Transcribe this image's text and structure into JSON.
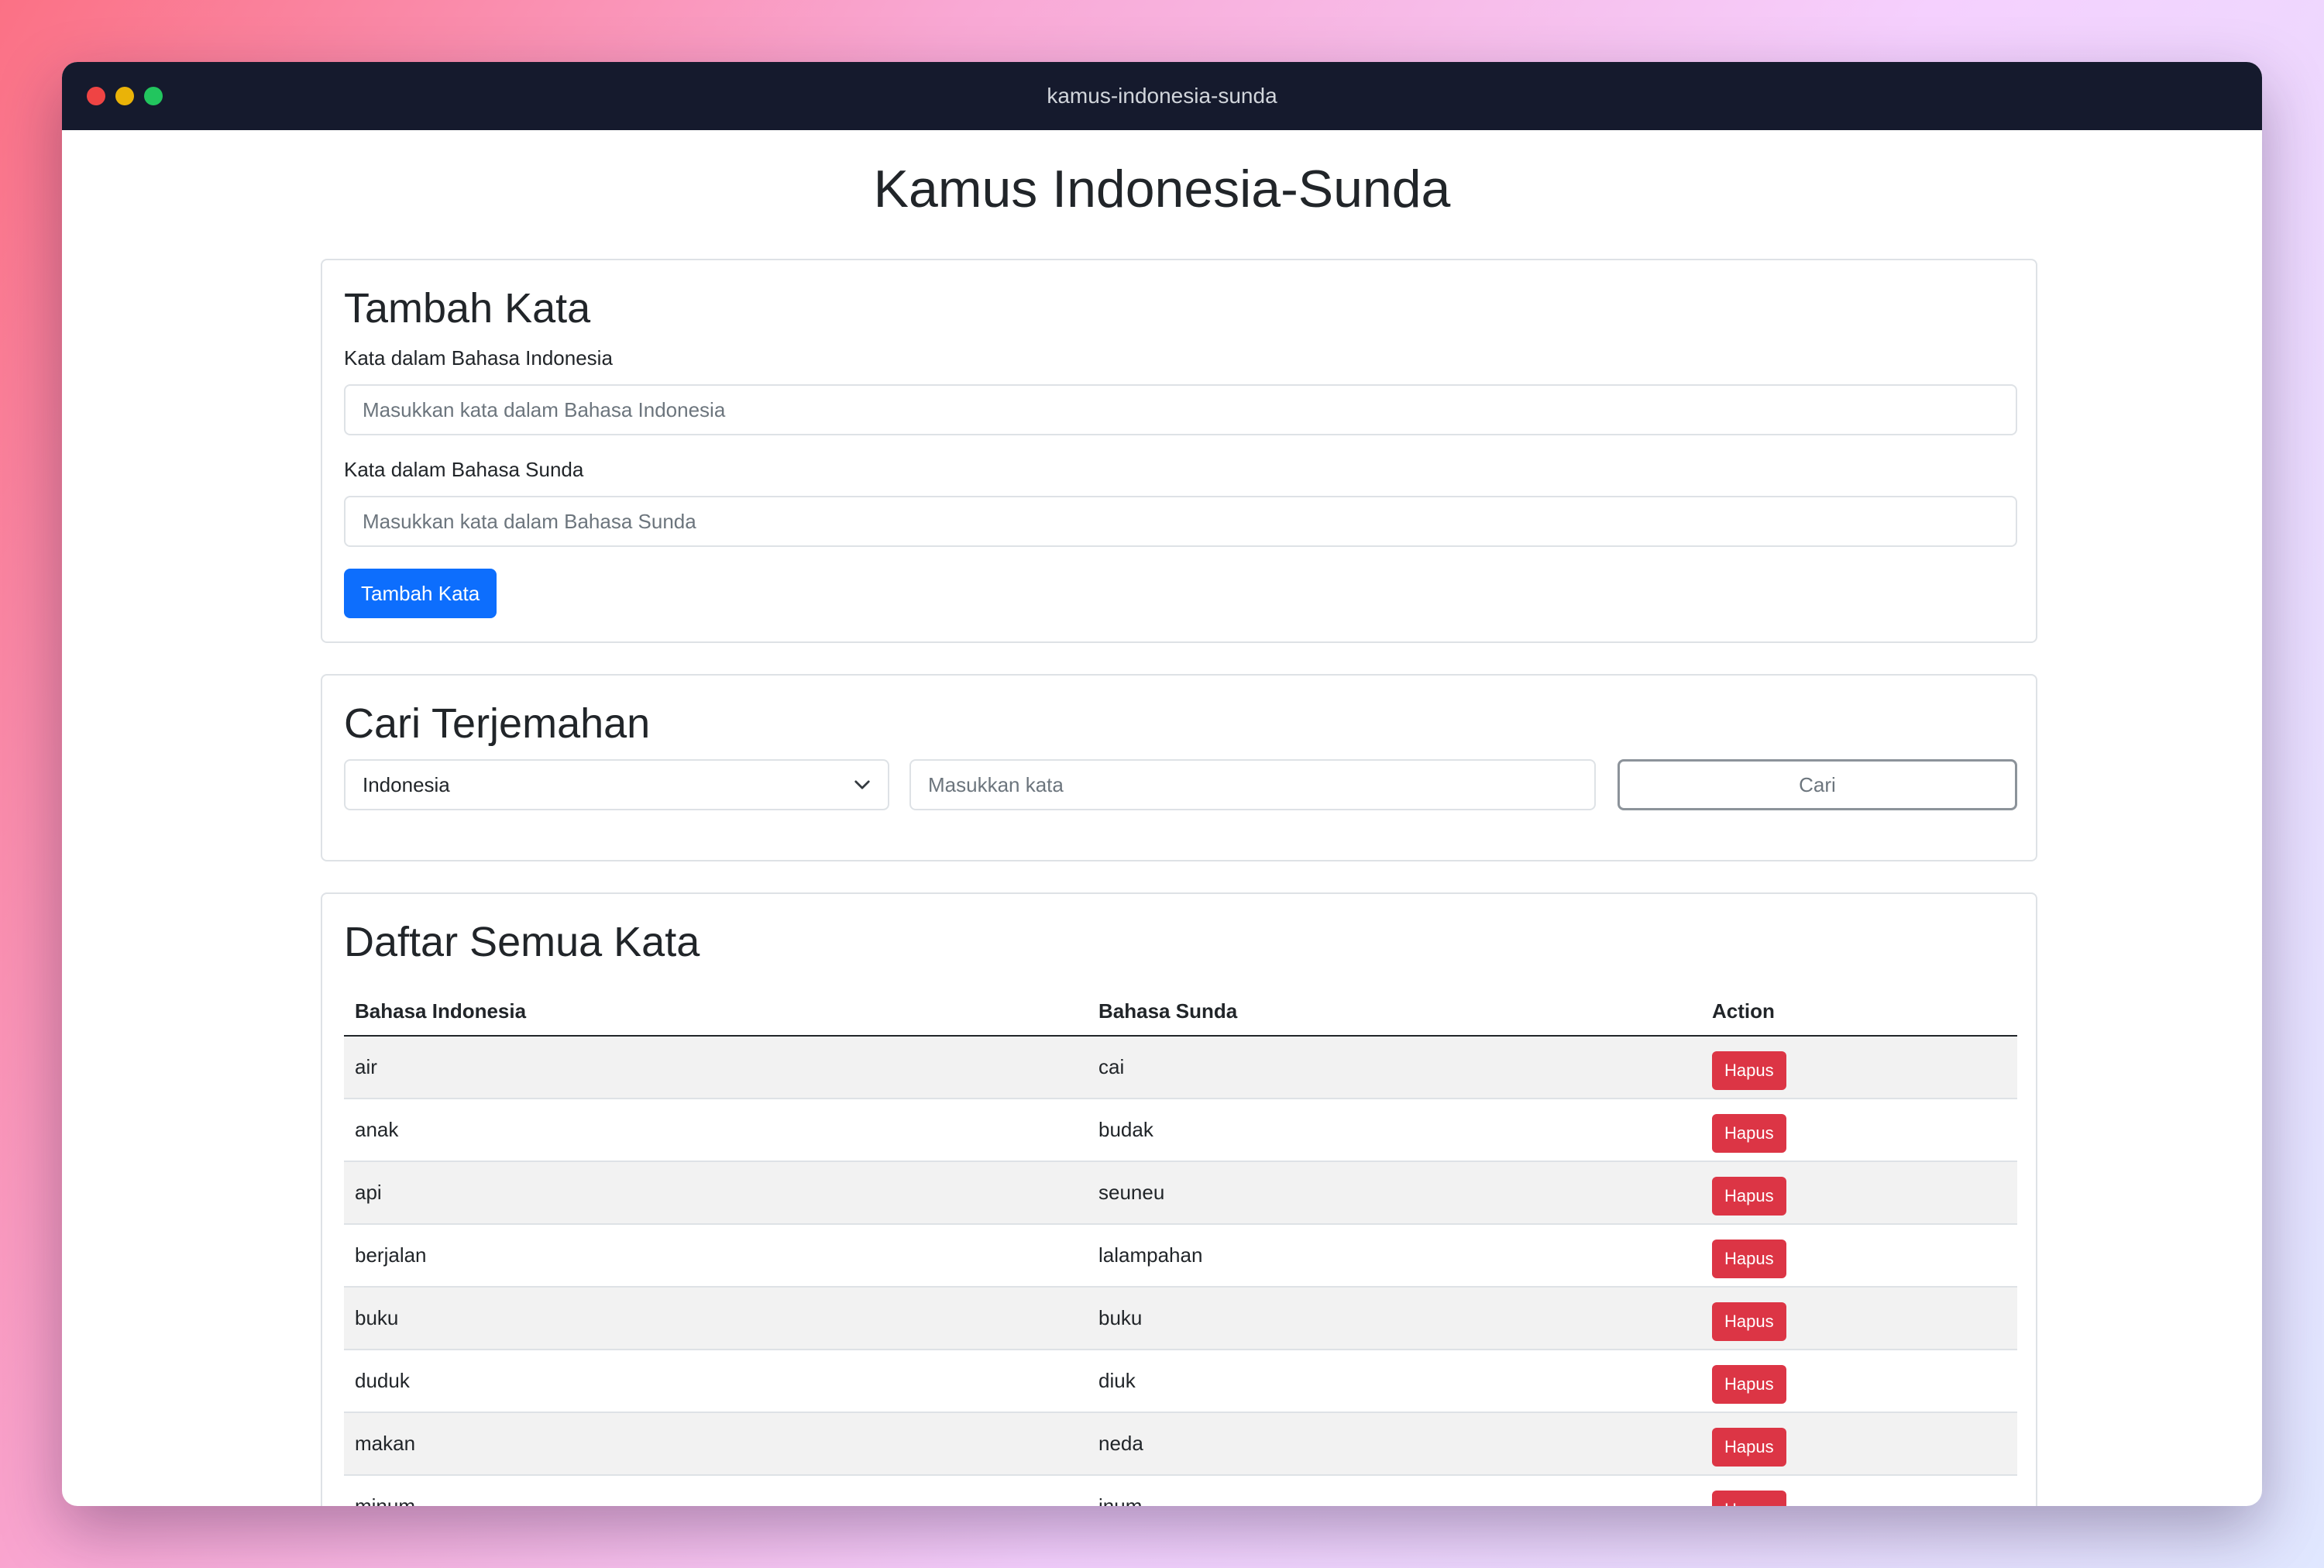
{
  "window": {
    "title": "kamus-indonesia-sunda"
  },
  "page": {
    "title": "Kamus Indonesia-Sunda"
  },
  "add_word": {
    "heading": "Tambah Kata",
    "indonesian_label": "Kata dalam Bahasa Indonesia",
    "indonesian_placeholder": "Masukkan kata dalam Bahasa Indonesia",
    "indonesian_value": "",
    "sundanese_label": "Kata dalam Bahasa Sunda",
    "sundanese_placeholder": "Masukkan kata dalam Bahasa Sunda",
    "sundanese_value": "",
    "submit_label": "Tambah Kata"
  },
  "search": {
    "heading": "Cari Terjemahan",
    "language_selected": "Indonesia",
    "word_placeholder": "Masukkan kata",
    "word_value": "",
    "button_label": "Cari"
  },
  "word_list": {
    "heading": "Daftar Semua Kata",
    "columns": [
      "Bahasa Indonesia",
      "Bahasa Sunda",
      "Action"
    ],
    "rows": [
      {
        "indonesia": "air",
        "sunda": "cai",
        "action": "Hapus"
      },
      {
        "indonesia": "anak",
        "sunda": "budak",
        "action": "Hapus"
      },
      {
        "indonesia": "api",
        "sunda": "seuneu",
        "action": "Hapus"
      },
      {
        "indonesia": "berjalan",
        "sunda": "lalampahan",
        "action": "Hapus"
      },
      {
        "indonesia": "buku",
        "sunda": "buku",
        "action": "Hapus"
      },
      {
        "indonesia": "duduk",
        "sunda": "diuk",
        "action": "Hapus"
      },
      {
        "indonesia": "makan",
        "sunda": "neda",
        "action": "Hapus"
      },
      {
        "indonesia": "minum",
        "sunda": "inum",
        "action": "Hapus"
      }
    ]
  },
  "colors": {
    "primary": "#0d6efd",
    "danger": "#dc3545",
    "titlebar": "#151a2d"
  }
}
